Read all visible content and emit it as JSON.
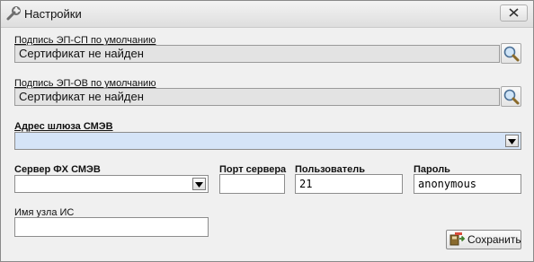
{
  "window": {
    "title": "Настройки"
  },
  "sign_sp": {
    "label": "Подпись ЭП-СП по умолчанию",
    "value": "Сертификат не найден"
  },
  "sign_ov": {
    "label": "Подпись ЭП-ОВ по умолчанию",
    "value": "Сертификат не найден"
  },
  "gateway": {
    "label": "Адрес шлюза СМЭВ",
    "value": ""
  },
  "server": {
    "label": "Сервер ФХ СМЭВ",
    "value": ""
  },
  "port": {
    "label": "Порт сервера",
    "value": ""
  },
  "user": {
    "label": "Пользователь",
    "value": "21"
  },
  "password": {
    "label": "Пароль",
    "value": "anonymous"
  },
  "node": {
    "label": "Имя узла ИС",
    "value": ""
  },
  "save_button": {
    "label": "Сохранить"
  },
  "icons": {
    "title": "tools-icon",
    "close": "close-icon",
    "search": "magnifier-icon",
    "dropdown": "triangle-down-icon",
    "save": "save-icon"
  }
}
